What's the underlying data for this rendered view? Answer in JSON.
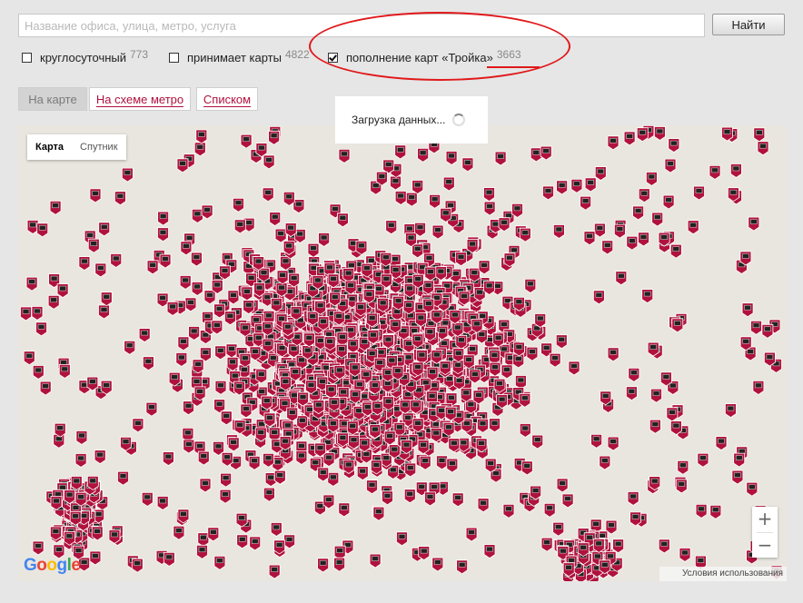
{
  "search": {
    "placeholder": "Название офиса, улица, метро, услуга",
    "button_label": "Найти"
  },
  "filters": [
    {
      "label": "круглосуточный",
      "count": "773",
      "checked": false
    },
    {
      "label": "принимает карты",
      "count": "4822",
      "checked": false
    },
    {
      "label": "пополнение карт «Тройка»",
      "count": "3663",
      "checked": true
    }
  ],
  "view_tabs": [
    {
      "label": "На карте",
      "active": true
    },
    {
      "label": "На схеме метро",
      "active": false
    },
    {
      "label": "Списком",
      "active": false
    }
  ],
  "map": {
    "type_options": [
      "Карта",
      "Спутник"
    ],
    "selected_type": "Карта",
    "zoom_in": "+",
    "zoom_out": "−",
    "logo": "Google",
    "terms": "Условия использования",
    "marker_color": "#b0123d"
  },
  "loading": {
    "text": "Загрузка данных..."
  },
  "annotation": {
    "color": "#e0191b"
  }
}
